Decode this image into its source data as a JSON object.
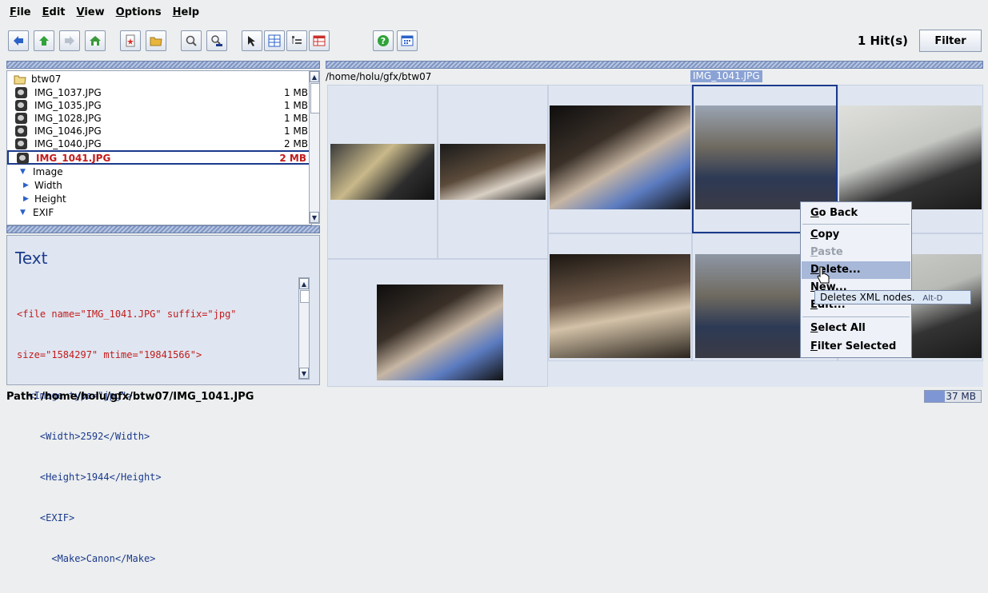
{
  "menu": [
    "File",
    "Edit",
    "View",
    "Options",
    "Help"
  ],
  "toolbar": {
    "icons": [
      "arrow-left-icon",
      "arrow-up-icon",
      "arrow-right-icon",
      "home-icon",
      "new-file-icon",
      "open-folder-icon",
      "search-icon",
      "info-search-icon",
      "pointer-icon",
      "grid-view-icon",
      "tree-view-icon",
      "table-view-icon",
      "help-icon",
      "calendar-icon"
    ],
    "hits": "1 Hit(s)",
    "filter_label": "Filter"
  },
  "tree": {
    "root": "btw07",
    "files": [
      {
        "name": "IMG_1037.JPG",
        "size": "1 MB"
      },
      {
        "name": "IMG_1035.JPG",
        "size": "1 MB"
      },
      {
        "name": "IMG_1028.JPG",
        "size": "1 MB"
      },
      {
        "name": "IMG_1046.JPG",
        "size": "1 MB"
      },
      {
        "name": "IMG_1040.JPG",
        "size": "2 MB"
      },
      {
        "name": "IMG_1041.JPG",
        "size": "2 MB"
      }
    ],
    "nodes": [
      "Image",
      "Width",
      "Height",
      "EXIF"
    ]
  },
  "text_panel": {
    "title": "Text",
    "lines": [
      "<file name=\"IMG_1041.JPG\" suffix=\"jpg\"",
      "size=\"1584297\" mtime=\"19841566\">",
      "  <Image type=\"jpg\">",
      "    <Width>2592</Width>",
      "    <Height>1944</Height>",
      "    <EXIF>",
      "      <Make>Canon</Make>"
    ]
  },
  "view": {
    "path": "/home/holu/gfx/btw07",
    "highlight_label": "IMG_1041.JPG"
  },
  "context_menu": {
    "items": [
      "Go Back",
      "Copy",
      "Paste",
      "Delete...",
      "New...",
      "Edit...",
      "Select All",
      "Filter Selected"
    ],
    "tooltip": "Deletes XML nodes.",
    "tooltip_shortcut": "Alt-D"
  },
  "status": {
    "path": "Path: /home/holu/gfx/btw07/IMG_1041.JPG",
    "memory": "37 MB",
    "memory_fill": 0.35
  },
  "colors": {
    "accent": "#1b3a8c",
    "selected_text": "#c21b1b",
    "panel_bg": "#dfe6f1"
  }
}
